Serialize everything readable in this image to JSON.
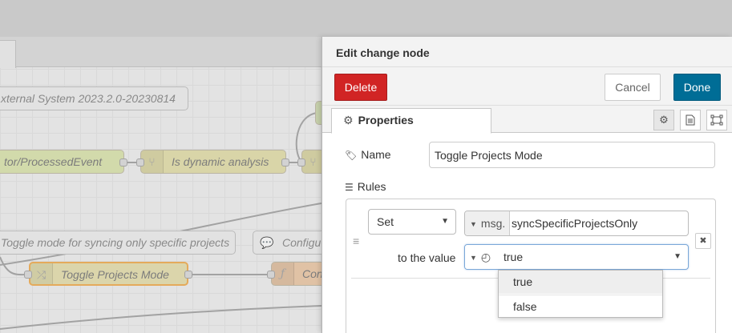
{
  "canvas": {
    "comments": [
      {
        "text": "xternal System 2023.2.0-20230814"
      },
      {
        "text": "Toggle mode for syncing only specific projects"
      },
      {
        "text": "Configu"
      }
    ],
    "nodes": [
      {
        "label": "tor/ProcessedEvent"
      },
      {
        "label": "Is dynamic analysis"
      },
      {
        "label": "Toggle Projects Mode"
      },
      {
        "label": "Conn"
      }
    ]
  },
  "tray": {
    "title": "Edit change node",
    "buttons": {
      "delete": "Delete",
      "cancel": "Cancel",
      "done": "Done"
    },
    "tabs": {
      "properties": "Properties"
    },
    "name_label": "Name",
    "name_value": "Toggle Projects Mode",
    "rules_label": "Rules",
    "rule": {
      "action": "Set",
      "target_type": "msg.",
      "target_value": "syncSpecificProjectsOnly",
      "to_label": "to the value",
      "value_selected": "true"
    },
    "dropdown_options": [
      "true",
      "false"
    ],
    "remove_label": "✖"
  }
}
